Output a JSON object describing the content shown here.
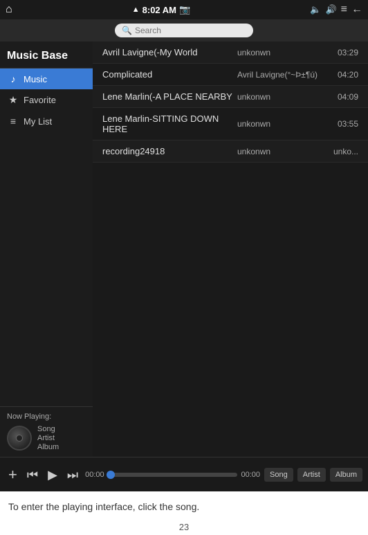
{
  "statusBar": {
    "signal": "▲",
    "time": "8:02 AM",
    "camera_icon": "📷",
    "volume_icon": "🔊",
    "speaker_icon": "🔈",
    "menu_icon": "≡",
    "back_icon": "←",
    "home_icon": "⌂"
  },
  "search": {
    "placeholder": "Search"
  },
  "sidebar": {
    "title": "Music Base",
    "items": [
      {
        "id": "music",
        "label": "Music",
        "icon": "♪",
        "active": true
      },
      {
        "id": "favorite",
        "label": "Favorite",
        "icon": "★"
      },
      {
        "id": "mylist",
        "label": "My List",
        "icon": "≡"
      }
    ]
  },
  "nowPlaying": {
    "label": "Now Playing:",
    "song": "Song",
    "artist": "Artist",
    "album": "Album"
  },
  "songs": [
    {
      "title": "Avril Lavigne(-My World",
      "artist": "unkonwn",
      "duration": "03:29"
    },
    {
      "title": "Complicated",
      "artist": "Avril Lavigne(°~Þ±¶ú)",
      "duration": "04:20"
    },
    {
      "title": "Lene Marlin(-A PLACE NEARBY",
      "artist": "unkonwn",
      "duration": "04:09"
    },
    {
      "title": "Lene Marlin-SITTING DOWN HERE",
      "artist": "unkonwn",
      "duration": "03:55"
    },
    {
      "title": "recording24918",
      "artist": "unkonwn",
      "duration": "unko..."
    }
  ],
  "playback": {
    "currentTime": "00:00",
    "totalTime": "00:00",
    "progressPercent": 2,
    "addBtn": "+",
    "prevBtn": "⏮",
    "playBtn": "▶",
    "nextBtn": "⏭"
  },
  "viewButtons": [
    {
      "id": "song",
      "label": "Song",
      "active": false
    },
    {
      "id": "artist",
      "label": "Artist",
      "active": false
    },
    {
      "id": "album",
      "label": "Album",
      "active": false
    }
  ],
  "hintText": "To enter the playing interface, click the song.",
  "pageNumber": "23"
}
